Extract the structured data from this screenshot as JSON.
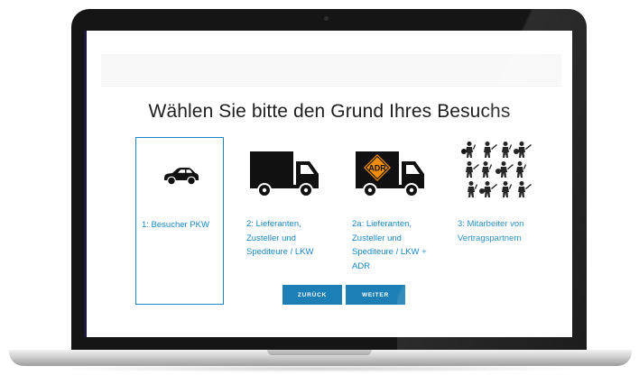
{
  "page": {
    "title": "Wählen Sie bitte den Grund Ihres Besuchs"
  },
  "options": [
    {
      "label": "1: Besucher PKW",
      "icon": "car-icon",
      "selected": true
    },
    {
      "label": "2: Lieferanten, Zusteller und Spediteure / LKW",
      "icon": "truck-icon",
      "selected": false
    },
    {
      "label": "2a: Lieferanten, Zusteller und Spediteure / LKW + ADR",
      "icon": "hazmat-truck-icon",
      "badge": "ADR",
      "selected": false
    },
    {
      "label": "3: Mitarbeiter von Vertragspartnern",
      "icon": "workers-icon",
      "selected": false
    }
  ],
  "buttons": {
    "back": "ZURÜCK",
    "next": "WEITER"
  },
  "colors": {
    "accent": "#1a86c2",
    "button": "#1c7fb5",
    "adr_orange": "#f28c00"
  }
}
